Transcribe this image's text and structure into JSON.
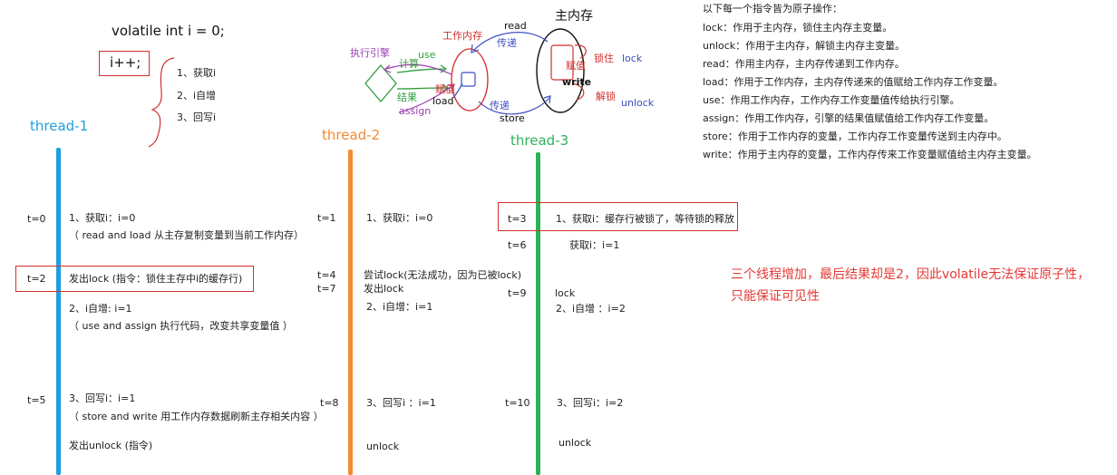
{
  "header": {
    "code_line": "volatile int i = 0;",
    "increment": "i++;",
    "steps": [
      "1、获取i",
      "2、i自增",
      "3、回写i"
    ]
  },
  "memory_diagram": {
    "main_memory": "主内存",
    "work_memory": "工作内存",
    "exec_engine": "执行引擎",
    "read": "read",
    "load": "load",
    "use": "use",
    "assign": "assign",
    "store": "store",
    "write": "write",
    "compute": "计算",
    "result": "结果",
    "assign_value_left": "赋值",
    "assign_value_right": "赋值",
    "transfer_top": "传递",
    "transfer_bottom": "传递",
    "lock_cn": "锁住",
    "lock": "lock",
    "unlock_cn": "解锁",
    "unlock": "unlock"
  },
  "atomic_ops": {
    "title": "以下每一个指令皆为原子操作：",
    "items": [
      "lock：作用于主内存，锁住主内存主变量。",
      "unlock：作用于主内存，解锁主内存主变量。",
      "read：作用主内存，主内存传递到工作内存。",
      "load：作用于工作内存，主内存传递来的值赋给工作内存工作变量。",
      "use：作用工作内存，工作内存工作变量值传给执行引擎。",
      "assign：作用工作内存，引擎的结果值赋值给工作内存工作变量。",
      "store：作用于工作内存的变量，工作内存工作变量传送到主内存中。",
      "write：作用于主内存的变量，工作内存传来工作变量赋值给主内存主变量。"
    ]
  },
  "threads": [
    {
      "name": "thread-1",
      "color": "#1e9fe0"
    },
    {
      "name": "thread-2",
      "color": "#f28a2e"
    },
    {
      "name": "thread-3",
      "color": "#2fb15a"
    }
  ],
  "thread1": {
    "t0": "t=0",
    "s1": "1、获取i：i=0",
    "s1_note": "（ read and load 从主存复制变量到当前工作内存）",
    "t2": "t=2",
    "lock_text": "发出lock (指令：锁住主存中i的缓存行)",
    "s2": "2、i自增: i=1",
    "s2_note": "（ use and assign  执行代码，改变共享变量值 ）",
    "t5": "t=5",
    "s3": "3、回写i：i=1",
    "s3_note": "（ store and write 用工作内存数据刷新主存相关内容 ）",
    "unlock_text": "发出unlock (指令)"
  },
  "thread2": {
    "t1": "t=1",
    "s1": "1、获取i：i=0",
    "t4": "t=4",
    "t7": "t=7",
    "try_lock": "尝试lock(无法成功，因为已被lock)",
    "issue_lock": "发出lock",
    "s2": "2、i自增：i=1",
    "t8": "t=8",
    "s3": "3、回写i ：i=1",
    "unlock": "unlock"
  },
  "thread3": {
    "t3": "t=3",
    "s1": "1、获取i：缓存行被锁了，等待锁的释放",
    "t6": "t=6",
    "s1b": "获取i：i=1",
    "t9": "t=9",
    "lock": "lock",
    "s2": "2、i自增  ：i=2",
    "t10": "t=10",
    "s3": "3、回写i：i=2",
    "unlock": "unlock"
  },
  "conclusion": {
    "line1": "三个线程增加，最后结果却是2，因此volatile无法保证原子性，",
    "line2": "只能保证可见性"
  },
  "colors": {
    "accent_red": "#d32f2f",
    "note_red": "#e53935",
    "green": "#2e9e3e",
    "purple": "#9c3fb0",
    "blue": "#3c4fc0"
  }
}
